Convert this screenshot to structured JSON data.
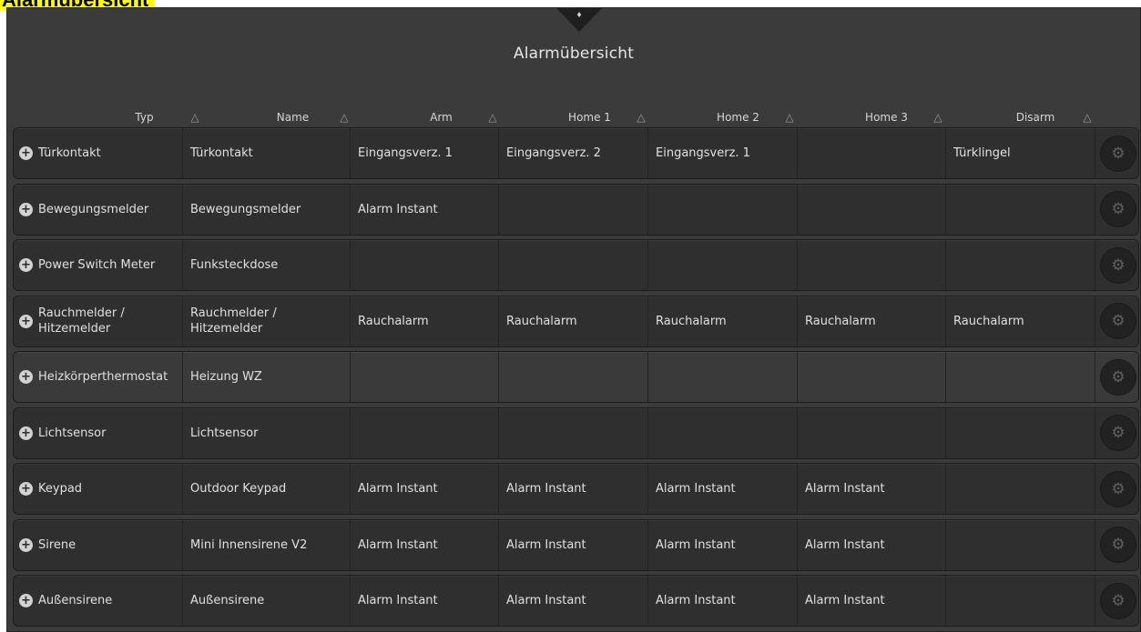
{
  "page_heading": "Alarmübersicht",
  "panel": {
    "title": "Alarmübersicht",
    "bell_icon": "bell-icon"
  },
  "columns": [
    "Typ",
    "Name",
    "Arm",
    "Home 1",
    "Home 2",
    "Home 3",
    "Disarm"
  ],
  "rows": [
    {
      "typ": "Türkontakt",
      "name": "Türkontakt",
      "arm": "Eingangsverz. 1",
      "home1": "Eingangsverz. 2",
      "home2": "Eingangsverz. 1",
      "home3": "",
      "disarm": "Türklingel"
    },
    {
      "typ": "Bewegungsmelder",
      "name": "Bewegungsmelder",
      "arm": "Alarm Instant",
      "home1": "",
      "home2": "",
      "home3": "",
      "disarm": ""
    },
    {
      "typ": "Power Switch Meter",
      "name": "Funksteckdose",
      "arm": "",
      "home1": "",
      "home2": "",
      "home3": "",
      "disarm": ""
    },
    {
      "typ": "Rauchmelder / Hitzemelder",
      "name": "Rauchmelder / Hitzemelder",
      "arm": "Rauchalarm",
      "home1": "Rauchalarm",
      "home2": "Rauchalarm",
      "home3": "Rauchalarm",
      "disarm": "Rauchalarm"
    },
    {
      "typ": "Heizkörperthermostat",
      "name": "Heizung WZ",
      "arm": "",
      "home1": "",
      "home2": "",
      "home3": "",
      "disarm": ""
    },
    {
      "typ": "Lichtsensor",
      "name": "Lichtsensor",
      "arm": "",
      "home1": "",
      "home2": "",
      "home3": "",
      "disarm": ""
    },
    {
      "typ": "Keypad",
      "name": "Outdoor Keypad",
      "arm": "Alarm Instant",
      "home1": "Alarm Instant",
      "home2": "Alarm Instant",
      "home3": "Alarm Instant",
      "disarm": ""
    },
    {
      "typ": "Sirene",
      "name": "Mini Innensirene V2",
      "arm": "Alarm Instant",
      "home1": "Alarm Instant",
      "home2": "Alarm Instant",
      "home3": "Alarm Instant",
      "disarm": ""
    },
    {
      "typ": "Außensirene",
      "name": "Außensirene",
      "arm": "Alarm Instant",
      "home1": "Alarm Instant",
      "home2": "Alarm Instant",
      "home3": "Alarm Instant",
      "disarm": ""
    }
  ],
  "highlighted_row": 4,
  "icons": {
    "expand": "plus-icon",
    "settings": "gear-icon",
    "sort": "sort-triangle-icon"
  },
  "colors": {
    "heading_background": "#ffff00",
    "panel_background": "#3b3b3b",
    "row_background": "#2f2f2f",
    "text": "#e0e0e0"
  }
}
